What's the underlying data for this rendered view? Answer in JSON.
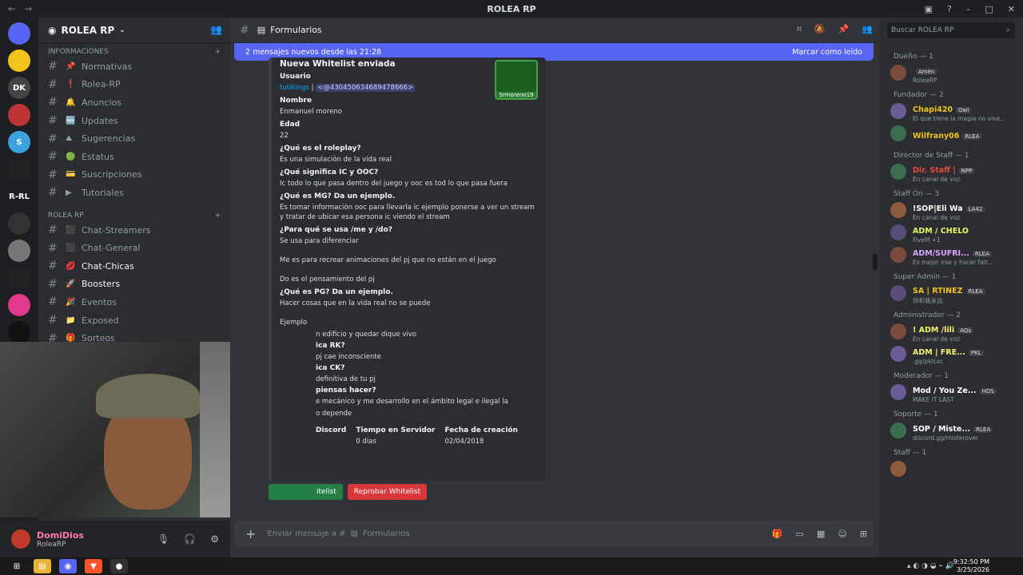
{
  "window": {
    "title": "ROLEA RP"
  },
  "servers": [
    {
      "label": "",
      "color": "#5865f2",
      "badge": "2"
    },
    {
      "label": "",
      "color": "#f0c419",
      "badge": ""
    },
    {
      "label": "DK",
      "color": "#444",
      "badge": ""
    },
    {
      "label": "",
      "color": "#b33",
      "badge": "2"
    },
    {
      "label": "S",
      "color": "#3ba3e0",
      "badge": ""
    },
    {
      "label": "",
      "color": "#222",
      "badge": ""
    },
    {
      "label": "R-RL",
      "color": "#1e1f22",
      "badge": ""
    },
    {
      "label": "",
      "color": "#333",
      "badge": ""
    },
    {
      "label": "",
      "color": "#777",
      "badge": ""
    },
    {
      "label": "",
      "color": "#222",
      "badge": ""
    },
    {
      "label": "",
      "color": "#e03a8c",
      "badge": "2"
    },
    {
      "label": "",
      "color": "#111",
      "badge": ""
    }
  ],
  "guild": {
    "name": "ROLEA RP"
  },
  "categories": {
    "info": "INFORMACIONES",
    "rolea": "ROLEA RP"
  },
  "channels_info": [
    {
      "name": "Normativas",
      "emoji": "📌"
    },
    {
      "name": "Rolea-RP",
      "emoji": "❗"
    },
    {
      "name": "Anuncios",
      "emoji": "🔔"
    },
    {
      "name": "Updates",
      "emoji": "🆕"
    },
    {
      "name": "Sugerencias",
      "emoji": "⛰"
    },
    {
      "name": "Estatus",
      "emoji": "🟢"
    },
    {
      "name": "Suscripciones",
      "emoji": "💳"
    },
    {
      "name": "Tutoriales",
      "emoji": "▶"
    }
  ],
  "channels_rolea": [
    {
      "name": "Chat-Streamers",
      "emoji": "⬛"
    },
    {
      "name": "Chat-General",
      "emoji": "⬛"
    },
    {
      "name": "Chat-Chicas",
      "emoji": "💋"
    },
    {
      "name": "Boosters",
      "emoji": "🚀"
    },
    {
      "name": "Eventos",
      "emoji": "🎉"
    },
    {
      "name": "Exposed",
      "emoji": "📁"
    },
    {
      "name": "Sorteos",
      "emoji": "🎁"
    }
  ],
  "user": {
    "name": "DomiDios",
    "status": "RoleaRP"
  },
  "channel_header": {
    "name": "Formularios"
  },
  "new_messages": {
    "text": "2 mensajes nuevos desde las 21:28",
    "mark_read": "Marcar como leído"
  },
  "embed": {
    "title": "Nueva Whitelist enviada",
    "thumb_label": "Srmoreno19",
    "usuario_label": "Usuario",
    "usuario_name": "tutikings",
    "usuario_sep": " | ",
    "usuario_mention": "<@430450634689478666>",
    "qa": [
      {
        "q": "Nombre",
        "a": "Enmanuel moreno"
      },
      {
        "q": "Edad",
        "a": "22"
      },
      {
        "q": "¿Qué es el roleplay?",
        "a": "Es una simulación de la vida real"
      },
      {
        "q": "¿Qué significa IC y OOC?",
        "a": "Ic todo lo que pasa dentro del juego y ooc es tod lo que pasa fuera"
      },
      {
        "q": "¿Qué es MG? Da un ejemplo.",
        "a": "Es tomar información ooc para llevarla ic ejemplo ponerse a ver un stream y tratar de ubicar esa persona ic viendo el stream"
      },
      {
        "q": "¿Para qué se usa /me y /do?",
        "a": "Se usa para diferenciar\n\nMe es para recrear animaciones del pj que no están en el juego\n\nDo es el pensamiento del pj"
      },
      {
        "q": "¿Qué es PG? Da un ejemplo.",
        "a": "Hacer cosas que en la vida real no se puede\n\nEjemplo"
      }
    ],
    "partial_lines": [
      "n edificio y quedar dique vivo",
      "ica RK?",
      "pj cae inconsciente",
      "ica CK?",
      "definitiva de tu pj",
      "piensas hacer?",
      "e mecánico y me desarrollo en el ámbito legal e ilegal la",
      "o depende"
    ],
    "fields": [
      {
        "label": "Discord",
        "value": ""
      },
      {
        "label": "Tiempo en Servidor",
        "value": "0 días"
      },
      {
        "label": "Fecha de creación",
        "value": "02/04/2018"
      }
    ]
  },
  "buttons": {
    "approve": "itelist",
    "reject": "Reprobar Whitelist"
  },
  "composer": {
    "placeholder": "Enviar mensaje a #",
    "channel": "Formularios"
  },
  "search": {
    "placeholder": "Buscar ROLEA RP"
  },
  "members": [
    {
      "role": "Dueño — 1",
      "people": [
        {
          "name": "",
          "sub": "RoleaRP",
          "tag": "Amén",
          "color": "#5865f2"
        }
      ]
    },
    {
      "role": "Fundador — 2",
      "people": [
        {
          "name": "Chapi420",
          "sub": "El que tiene la magia no vive...",
          "tag": "Owl",
          "color": "#f0c419"
        },
        {
          "name": "Wilfrany06",
          "sub": "",
          "tag": "RLEA",
          "color": "#f0c419"
        }
      ]
    },
    {
      "role": "Director de Staff — 1",
      "people": [
        {
          "name": "Dir. Staff |",
          "sub": "En canal de voz",
          "tag": "NPP",
          "color": "#e74c3c"
        }
      ]
    },
    {
      "role": "Staff On — 3",
      "people": [
        {
          "name": "!SOP|Eli Wa",
          "sub": "En canal de voz",
          "tag": "LA42",
          "color": "#ffffff"
        },
        {
          "name": "ADM / CHELO",
          "sub": "FiveM +1",
          "tag": "",
          "color": "#e9f75a"
        },
        {
          "name": "ADM/SUFRI...",
          "sub": "Es mejor irse y hacer falt...",
          "tag": "RLEA",
          "color": "#d9a6ff"
        }
      ]
    },
    {
      "role": "Super Admin — 1",
      "people": [
        {
          "name": "SA | RTINEZ",
          "sub": "你和我永远",
          "tag": "RLEA",
          "color": "#f0c419"
        }
      ]
    },
    {
      "role": "Administrador — 2",
      "people": [
        {
          "name": "! ADM /lili",
          "sub": "En canal de voz",
          "tag": "AQs",
          "color": "#f7f16b"
        },
        {
          "name": "ADM | FRE...",
          "sub": ".gg/pklcxc",
          "tag": "PKL",
          "color": "#f7f16b"
        }
      ]
    },
    {
      "role": "Moderador — 1",
      "people": [
        {
          "name": "Mod / You Ze...",
          "sub": "MAKE IT LAST",
          "tag": "HDS",
          "color": "#ffffff"
        }
      ]
    },
    {
      "role": "Soporte — 1",
      "people": [
        {
          "name": "SOP / Miste...",
          "sub": "discord.gg/misterover",
          "tag": "RLEA",
          "color": "#ffffff"
        }
      ]
    },
    {
      "role": "Staff — 1",
      "people": [
        {
          "name": "",
          "sub": "",
          "tag": "",
          "color": "#ffffff"
        }
      ]
    }
  ],
  "taskbar": {
    "time": "9:32:50 PM",
    "date": "3/25/2026"
  }
}
